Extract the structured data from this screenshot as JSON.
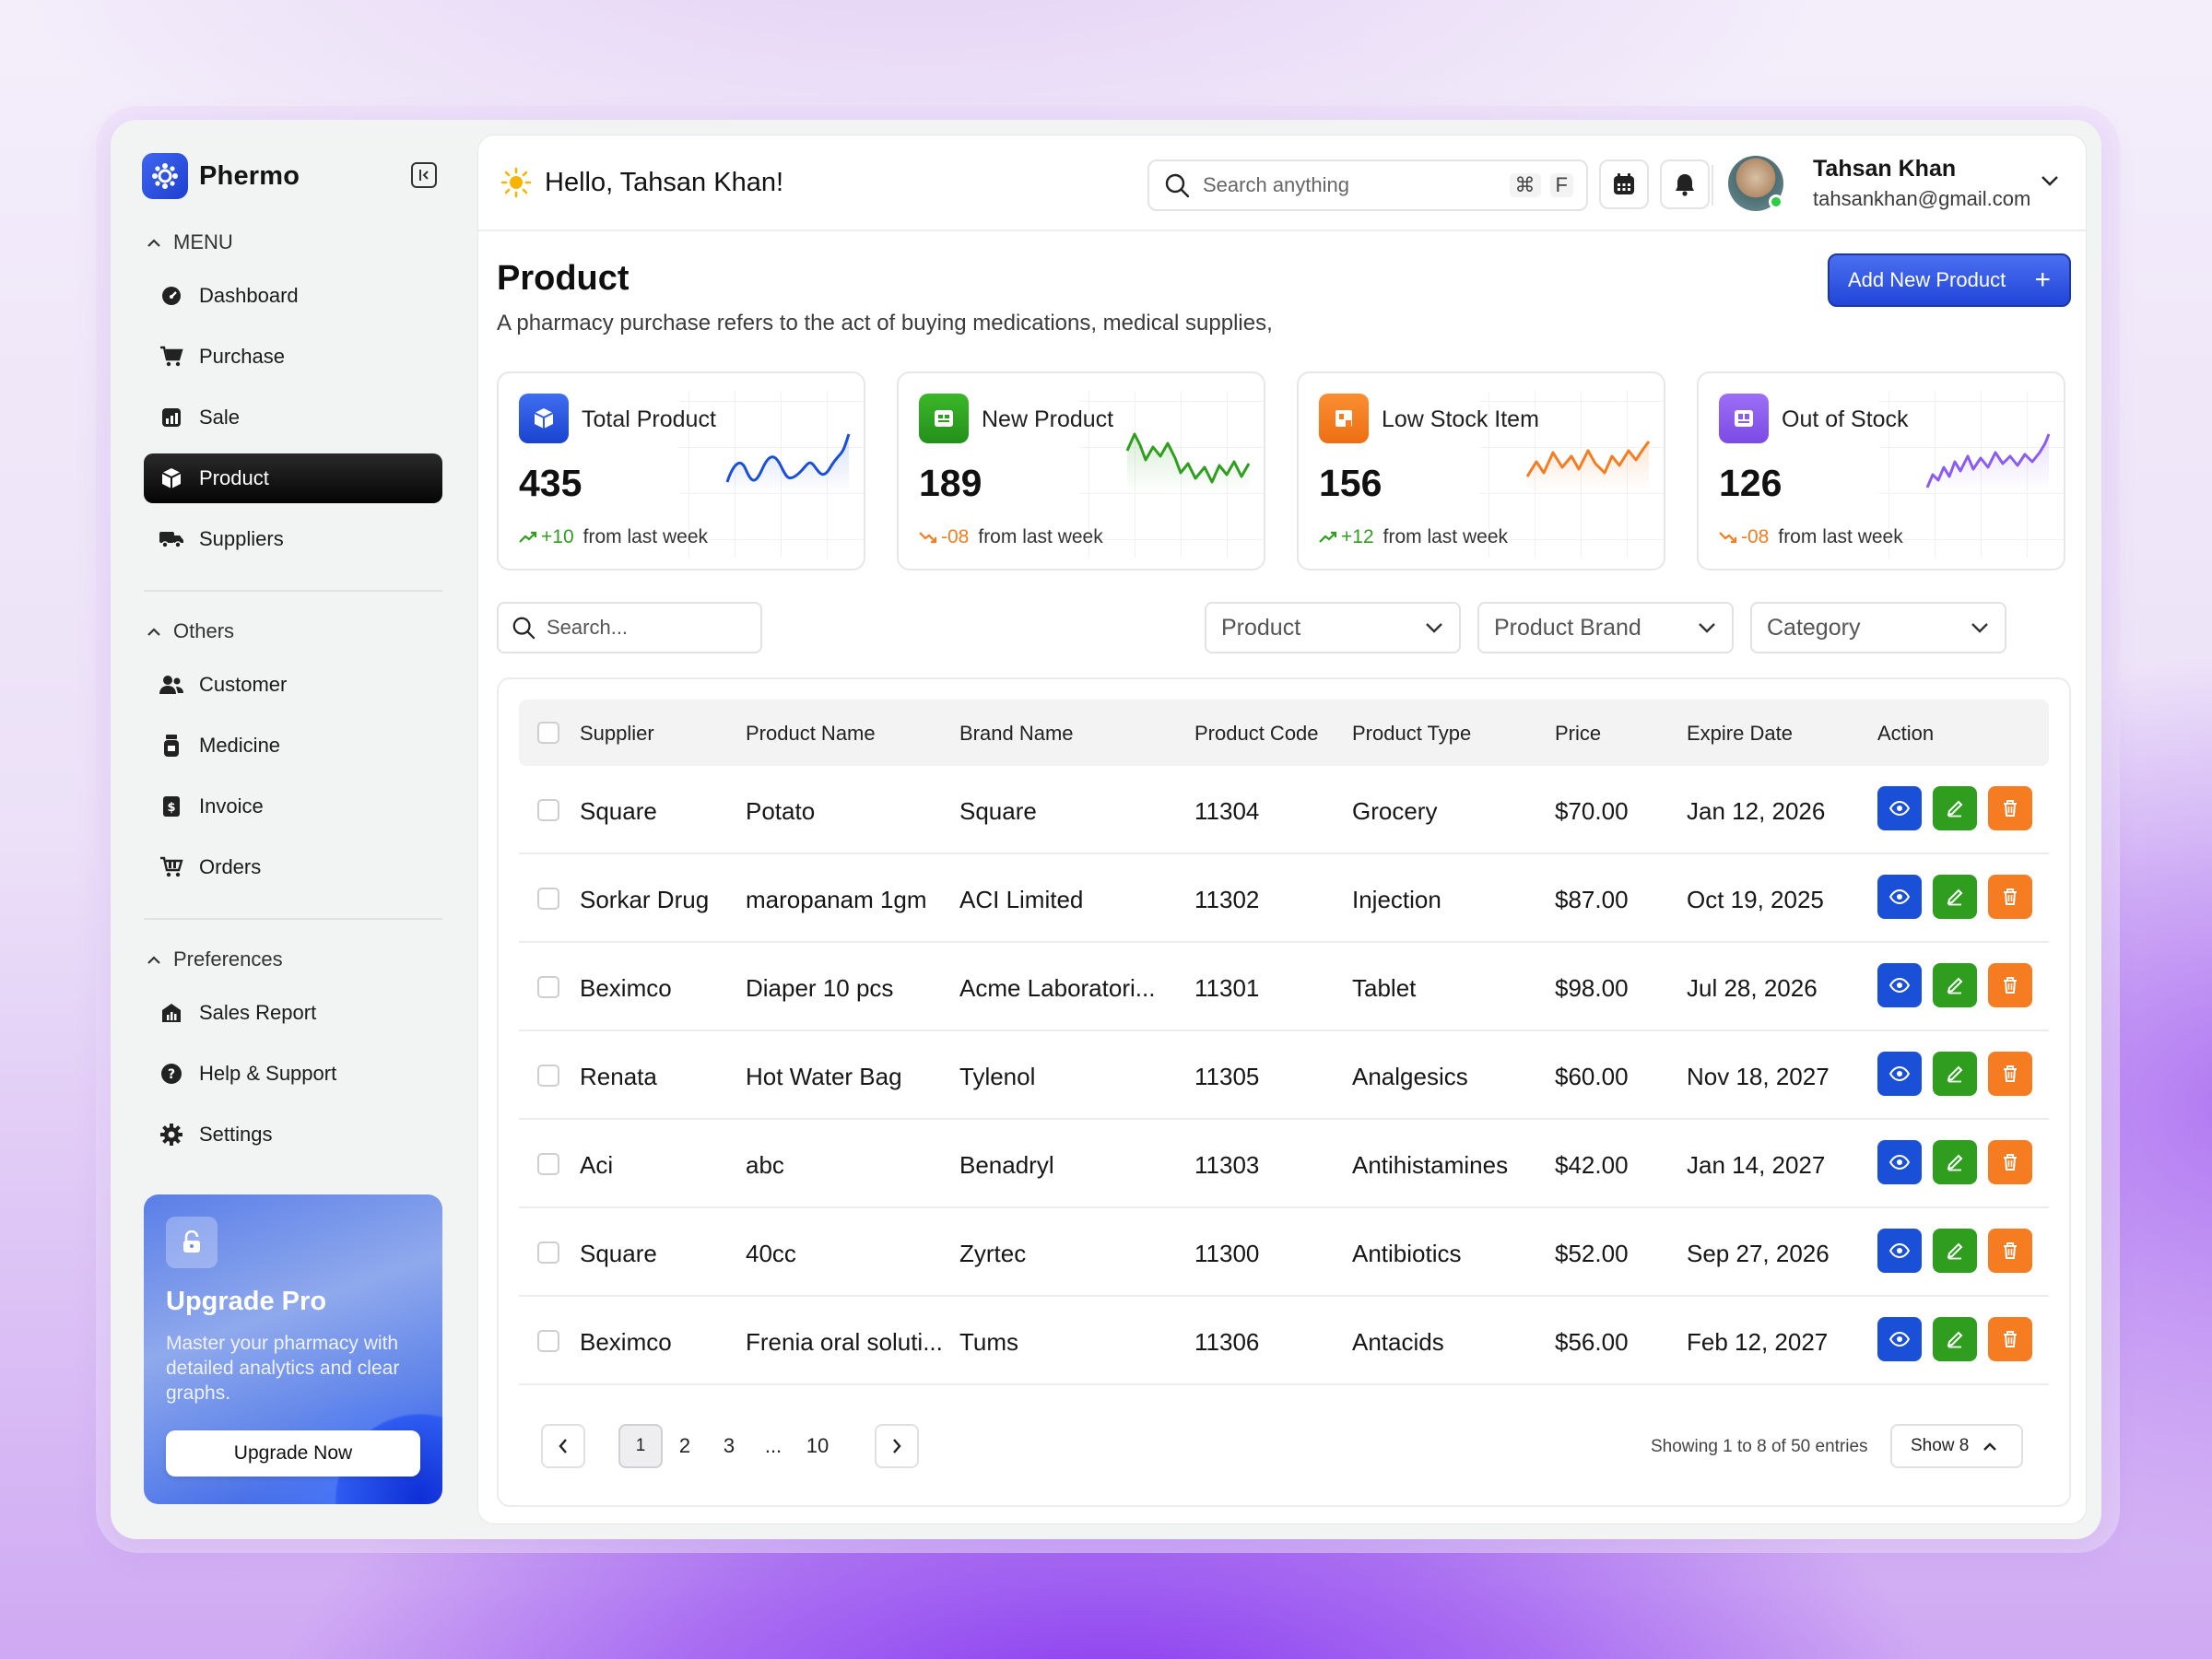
{
  "app": {
    "name": "Phermo"
  },
  "sidebar": {
    "menu_label": "MENU",
    "menu_items": [
      {
        "label": "Dashboard",
        "icon": "dashboard-icon"
      },
      {
        "label": "Purchase",
        "icon": "cart-icon"
      },
      {
        "label": "Sale",
        "icon": "sale-chart-icon"
      },
      {
        "label": "Product",
        "icon": "box-icon",
        "active": true
      },
      {
        "label": "Suppliers",
        "icon": "truck-icon"
      }
    ],
    "others_label": "Others",
    "other_items": [
      {
        "label": "Customer",
        "icon": "users-icon"
      },
      {
        "label": "Medicine",
        "icon": "medicine-bottle-icon"
      },
      {
        "label": "Invoice",
        "icon": "invoice-icon"
      },
      {
        "label": "Orders",
        "icon": "orders-cart-icon"
      }
    ],
    "preferences_label": "Preferences",
    "preference_items": [
      {
        "label": "Sales Report",
        "icon": "report-icon"
      },
      {
        "label": "Help & Support",
        "icon": "help-icon"
      },
      {
        "label": "Settings",
        "icon": "gear-icon"
      }
    ],
    "upgrade": {
      "title": "Upgrade Pro",
      "text": "Master your pharmacy with detailed analytics and clear graphs.",
      "button": "Upgrade Now"
    }
  },
  "header": {
    "greeting": "Hello, Tahsan Khan!",
    "search_placeholder": "Search anything",
    "shortcut_key1": "⌘",
    "shortcut_key2": "F",
    "user_name": "Tahsan Khan",
    "user_email": "tahsankhan@gmail.com"
  },
  "page": {
    "title": "Product",
    "subtitle": "A pharmacy purchase refers to the act of buying medications, medical supplies,",
    "add_button": "Add New Product"
  },
  "stats": [
    {
      "label": "Total Product",
      "value": "435",
      "change": "+10",
      "change_text": "from last week",
      "trend": "up",
      "color": "#1a4fd8"
    },
    {
      "label": "New Product",
      "value": "189",
      "change": "-08",
      "change_text": "from last week",
      "trend": "down",
      "color": "#2f9e1f"
    },
    {
      "label": "Low Stock Item",
      "value": "156",
      "change": "+12",
      "change_text": "from last week",
      "trend": "up",
      "color": "#f57c21"
    },
    {
      "label": "Out of Stock",
      "value": "126",
      "change": "-08",
      "change_text": "from last week",
      "trend": "down",
      "color": "#8b5cf0"
    }
  ],
  "filters": {
    "search_placeholder": "Search...",
    "product": "Product",
    "brand": "Product Brand",
    "category": "Category"
  },
  "table": {
    "columns": [
      "Supplier",
      "Product Name",
      "Brand Name",
      "Product Code",
      "Product Type",
      "Price",
      "Expire Date",
      "Action"
    ],
    "rows": [
      {
        "supplier": "Square",
        "product": "Potato",
        "brand": "Square",
        "code": "11304",
        "type": "Grocery",
        "price": "$70.00",
        "expire": "Jan 12, 2026"
      },
      {
        "supplier": "Sorkar Drug",
        "product": "maropanam 1gm",
        "brand": "ACI Limited",
        "code": "11302",
        "type": "Injection",
        "price": "$87.00",
        "expire": "Oct 19, 2025"
      },
      {
        "supplier": "Beximco",
        "product": "Diaper 10 pcs",
        "brand": "Acme Laboratori...",
        "code": "11301",
        "type": "Tablet",
        "price": "$98.00",
        "expire": "Jul 28, 2026"
      },
      {
        "supplier": "Renata",
        "product": "Hot Water Bag",
        "brand": "Tylenol",
        "code": "11305",
        "type": "Analgesics",
        "price": "$60.00",
        "expire": "Nov 18, 2027"
      },
      {
        "supplier": "Aci",
        "product": "abc",
        "brand": "Benadryl",
        "code": "11303",
        "type": "Antihistamines",
        "price": "$42.00",
        "expire": "Jan 14, 2027"
      },
      {
        "supplier": "Square",
        "product": "40cc",
        "brand": "Zyrtec",
        "code": "11300",
        "type": "Antibiotics",
        "price": "$52.00",
        "expire": "Sep 27, 2026"
      },
      {
        "supplier": "Beximco",
        "product": "Frenia oral soluti...",
        "brand": "Tums",
        "code": "11306",
        "type": "Antacids",
        "price": "$56.00",
        "expire": "Feb 12, 2027"
      }
    ]
  },
  "pagination": {
    "pages": [
      "1",
      "2",
      "3",
      "...",
      "10"
    ],
    "current": "1",
    "showing": "Showing 1 to 8 of 50 entries",
    "page_size": "Show 8"
  }
}
